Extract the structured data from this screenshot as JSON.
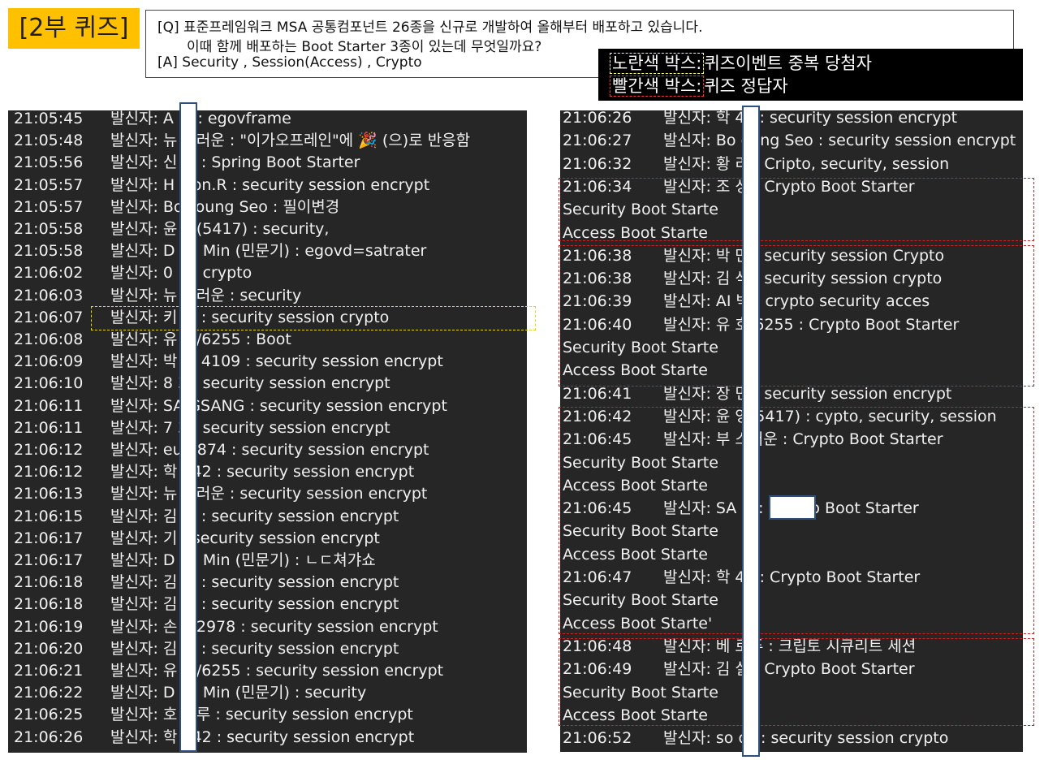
{
  "header": {
    "badge": "[2부 퀴즈]",
    "question_line1": "[Q] 표준프레임워크 MSA 공통컴포넌트 26종을 신규로 개발하여 올해부터 배포하고 있습니다.",
    "question_line2": "이때 함께 배포하는 Boot Starter 3종이 있는데 무엇일까요?",
    "answer_line": "[A] Security , Session(Access) , Crypto"
  },
  "legend": {
    "yellow_key": "노란색 박스:",
    "yellow_desc": "퀴즈이벤트 중복 당첨자",
    "red_key": "빨간색 박스:",
    "red_desc": "퀴즈 정답자",
    "yellow_color": "#e6d800",
    "red_color": "#d62020"
  },
  "chat_left": [
    {
      "time": "21:05:45",
      "msg": "발신자: A    박 : egovframe"
    },
    {
      "time": "21:05:48",
      "msg": "발신자: 뉴    스러운 : \"이가오프레인\"에 🎉 (으)로 반응함"
    },
    {
      "time": "21:05:56",
      "msg": "발신자: 신    식 : Spring Boot Starter"
    },
    {
      "time": "21:05:57",
      "msg": "발신자: H    won.R : security session encrypt"
    },
    {
      "time": "21:05:57",
      "msg": "발신자: Bo   Young Seo : 필이변경"
    },
    {
      "time": "21:05:58",
      "msg": "발신자: 윤    영(5417) : security,"
    },
    {
      "time": "21:05:58",
      "msg": "발신자: D    iel Min (민문기) : egovd=satrater"
    },
    {
      "time": "21:06:02",
      "msg": "발신자: 0    1 : crypto"
    },
    {
      "time": "21:06:03",
      "msg": "발신자: 뉴    스러운 : security"
    },
    {
      "time": "21:06:07",
      "msg": "발신자: 키    키 : security session crypto"
    },
    {
      "time": "21:06:08",
      "msg": "발신자: 유    호/6255 : Boot"
    },
    {
      "time": "21:06:09",
      "msg": "발신자: 박    영 4109 : security session encrypt"
    },
    {
      "time": "21:06:10",
      "msg": "발신자: 8    3 : security session encrypt"
    },
    {
      "time": "21:06:11",
      "msg": "발신자: SA    GSANG : security session encrypt"
    },
    {
      "time": "21:06:11",
      "msg": "발신자: 7    3 : security session encrypt"
    },
    {
      "time": "21:06:12",
      "msg": "발신자: eu    8874 : security session encrypt"
    },
    {
      "time": "21:06:12",
      "msg": "발신자: 학    242 : security session encrypt"
    },
    {
      "time": "21:06:13",
      "msg": "발신자: 뉴    스러운 : security session encrypt"
    },
    {
      "time": "21:06:15",
      "msg": "발신자: 김    실 : security session encrypt"
    },
    {
      "time": "21:06:17",
      "msg": "발신자: 기    : security session encrypt"
    },
    {
      "time": "21:06:17",
      "msg": "발신자: D    iel Min (민문기) : ㄴㄷ쳐갸쇼"
    },
    {
      "time": "21:06:18",
      "msg": "발신자: 김    수 : security session encrypt"
    },
    {
      "time": "21:06:18",
      "msg": "발신자: 김    찬 : security session encrypt"
    },
    {
      "time": "21:06:19",
      "msg": "발신자: 손    규2978 : security session encrypt"
    },
    {
      "time": "21:06:20",
      "msg": "발신자: 김    석 : security session encrypt"
    },
    {
      "time": "21:06:21",
      "msg": "발신자: 유    호/6255 : security session encrypt"
    },
    {
      "time": "21:06:22",
      "msg": "발신자: D    iel Min (민문기) : security"
    },
    {
      "time": "21:06:25",
      "msg": "발신자: 호    마루 : security session encrypt"
    },
    {
      "time": "21:06:26",
      "msg": "발신자: 학    242 : security session encrypt"
    }
  ],
  "chat_right": [
    {
      "time": "21:06:26",
      "msg": "발신자: 학    42 : security session encrypt"
    },
    {
      "time": "21:06:27",
      "msg": "발신자: Bo    oung Seo : security session encrypt"
    },
    {
      "time": "21:06:32",
      "msg": "발신자: 황    리 : Cripto, security, session"
    },
    {
      "time": "21:06:34",
      "msg": "발신자: 조    성 : Crypto Boot Starter"
    },
    {
      "time": "",
      "msg": "Security Boot Starte"
    },
    {
      "time": "",
      "msg": "Access Boot Starte"
    },
    {
      "time": "21:06:38",
      "msg": "발신자: 박    만 : security session Crypto"
    },
    {
      "time": "21:06:38",
      "msg": "발신자: 김    석 : security session crypto"
    },
    {
      "time": "21:06:39",
      "msg": "발신자: AI    박 : crypto security acces"
    },
    {
      "time": "21:06:40",
      "msg": "발신자: 유    호/6255 : Crypto Boot Starter"
    },
    {
      "time": "",
      "msg": "Security Boot Starte"
    },
    {
      "time": "",
      "msg": "Access Boot Starte"
    },
    {
      "time": "21:06:41",
      "msg": "발신자: 장    민 : security session encrypt"
    },
    {
      "time": "21:06:42",
      "msg": "발신자: 윤    영(5417) : cypto, security, session"
    },
    {
      "time": "21:06:45",
      "msg": "발신자: 부    스러운 : Crypto Boot Starter"
    },
    {
      "time": "",
      "msg": "Security Boot Starte"
    },
    {
      "time": "",
      "msg": "Access Boot Starte"
    },
    {
      "time": "21:06:45",
      "msg": "발신자: SA    G          : Crypto Boot Starter"
    },
    {
      "time": "",
      "msg": "Security Boot Starte"
    },
    {
      "time": "",
      "msg": "Access Boot Starte"
    },
    {
      "time": "21:06:47",
      "msg": "발신자: 학    42 : Crypto Boot Starter"
    },
    {
      "time": "",
      "msg": "Security Boot Starte"
    },
    {
      "time": "",
      "msg": "Access Boot Starte'"
    },
    {
      "time": "21:06:48",
      "msg": "발신자: 베    로푸 : 크립토 시큐리트 세션"
    },
    {
      "time": "21:06:49",
      "msg": "발신자: 김    실 : Crypto Boot Starter"
    },
    {
      "time": "",
      "msg": "Security Boot Starte"
    },
    {
      "time": "",
      "msg": "Access Boot Starte"
    },
    {
      "time": "21:06:52",
      "msg": "발신자: so    os : security session crypto"
    }
  ]
}
